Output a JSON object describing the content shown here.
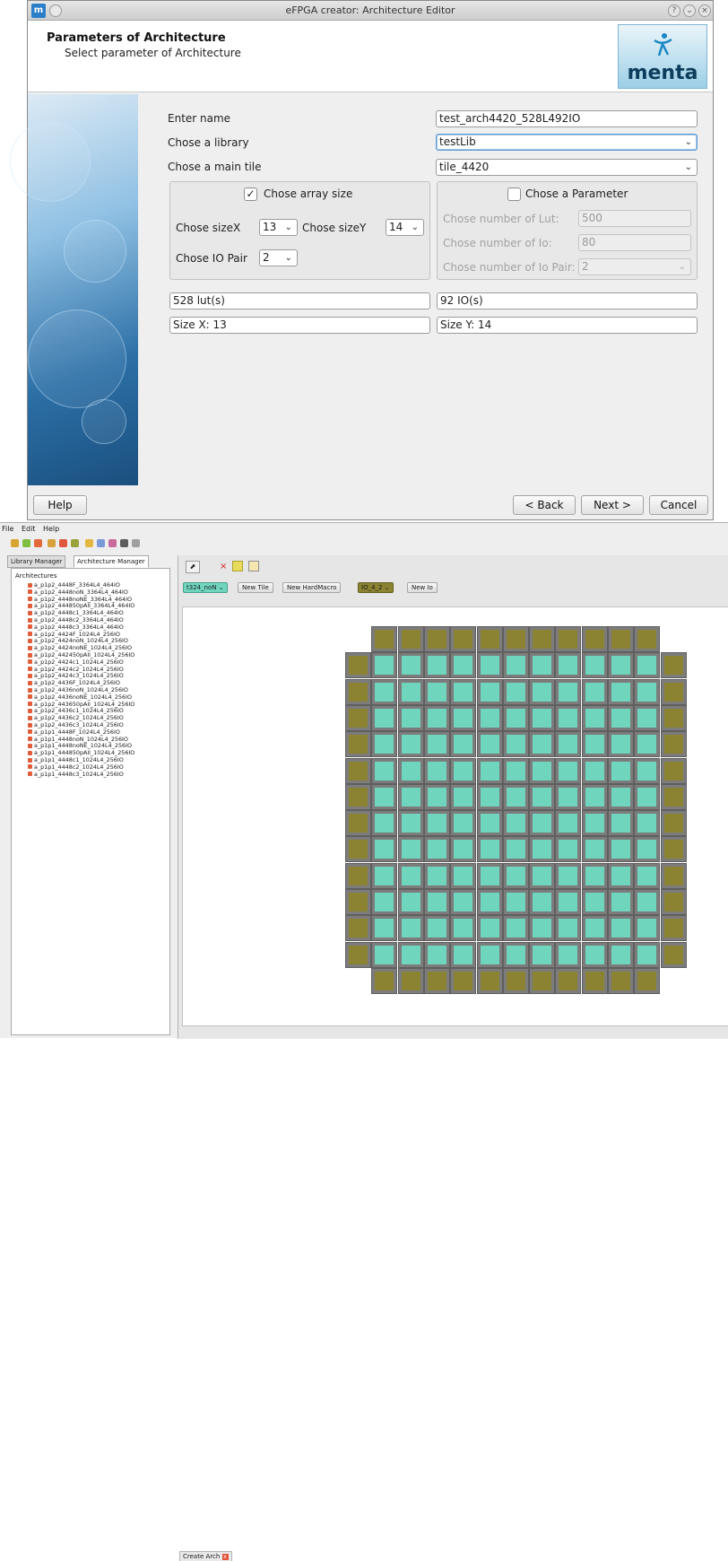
{
  "dialog": {
    "window_title": "eFPGA creator: Architecture Editor",
    "header_title": "Parameters of Architecture",
    "header_subtitle": "Select parameter of Architecture",
    "logo_text": "menta",
    "labels": {
      "name": "Enter name",
      "library": "Chose a library",
      "main_tile": "Chose a main tile",
      "array_size": "Chose array size",
      "size_x": "Chose sizeX",
      "size_y": "Chose sizeY",
      "io_pair": "Chose IO Pair",
      "parameter": "Chose a Parameter",
      "num_lut": "Chose number of Lut:",
      "num_io": "Chose number of Io:",
      "num_io_pair": "Chose number of Io Pair:"
    },
    "values": {
      "name": "test_arch4420_528L492IO",
      "library": "testLib",
      "main_tile": "tile_4420",
      "size_x": "13",
      "size_y": "14",
      "io_pair": "2",
      "num_lut": "500",
      "num_io": "80",
      "num_io_pair": "2",
      "luts": "528 lut(s)",
      "ios": "92 IO(s)",
      "size_x_summary": "Size X: 13",
      "size_y_summary": "Size Y: 14"
    },
    "array_size_checked": true,
    "parameter_checked": false,
    "buttons": {
      "help": "Help",
      "back": "< Back",
      "next": "Next >",
      "cancel": "Cancel"
    }
  },
  "ide": {
    "menu": [
      "File",
      "Edit",
      "Help"
    ],
    "tabs": {
      "library_manager": "Library Manager",
      "architecture_manager": "Architecture Manager"
    },
    "tree_root": "Architectures",
    "architectures": [
      "a_p1p2_4448F_3364L4_464IO",
      "a_p1p2_4448noN_3364L4_464IO",
      "a_p1p2_4448noNE_3364L4_464IO",
      "a_p1p2_444850pAll_3364L4_464IO",
      "a_p1p2_4448c1_3364L4_464IO",
      "a_p1p2_4448c2_3364L4_464IO",
      "a_p1p2_4448c3_3364L4_464IO",
      "a_p1p2_4424F_1024L4_256IO",
      "a_p1p2_4424noN_1024L4_256IO",
      "a_p1p2_4424noNE_1024L4_256IO",
      "a_p1p2_442450pAll_1024L4_256IO",
      "a_p1p2_4424c1_1024L4_256IO",
      "a_p1p2_4424c2_1024L4_256IO",
      "a_p1p2_4424c3_1024L4_256IO",
      "a_p1p2_4436F_1024L4_256IO",
      "a_p1p2_4436noN_1024L4_256IO",
      "a_p1p2_4436noNE_1024L4_256IO",
      "a_p1p2_443650pAll_1024L4_256IO",
      "a_p1p2_4436c1_1024L4_256IO",
      "a_p1p2_4436c2_1024L4_256IO",
      "a_p1p2_4436c3_1024L4_256IO",
      "a_p1p1_4448F_1024L4_256IO",
      "a_p1p1_4448noN_1024L4_256IO",
      "a_p1p1_4448noNE_1024L4_256IO",
      "a_p1p1_444850pAll_1024L4_256IO",
      "a_p1p1_4448c1_1024L4_256IO",
      "a_p1p1_4448c2_1024L4_256IO",
      "a_p1p1_4448c3_1024L4_256IO"
    ],
    "tile_combo": "t324_noN",
    "new_tile": "New Tile",
    "new_hardmacro": "New HardMacro",
    "io_combo": "IO_4_2",
    "new_io": "New Io",
    "bottom_tab": "Create Arch",
    "colors": {
      "io_cell": "#8b8232",
      "logic_cell": "#6fd6bd",
      "cell_frame": "#7c7c7c"
    },
    "grid": {
      "columns": 13,
      "rows": 14
    }
  }
}
